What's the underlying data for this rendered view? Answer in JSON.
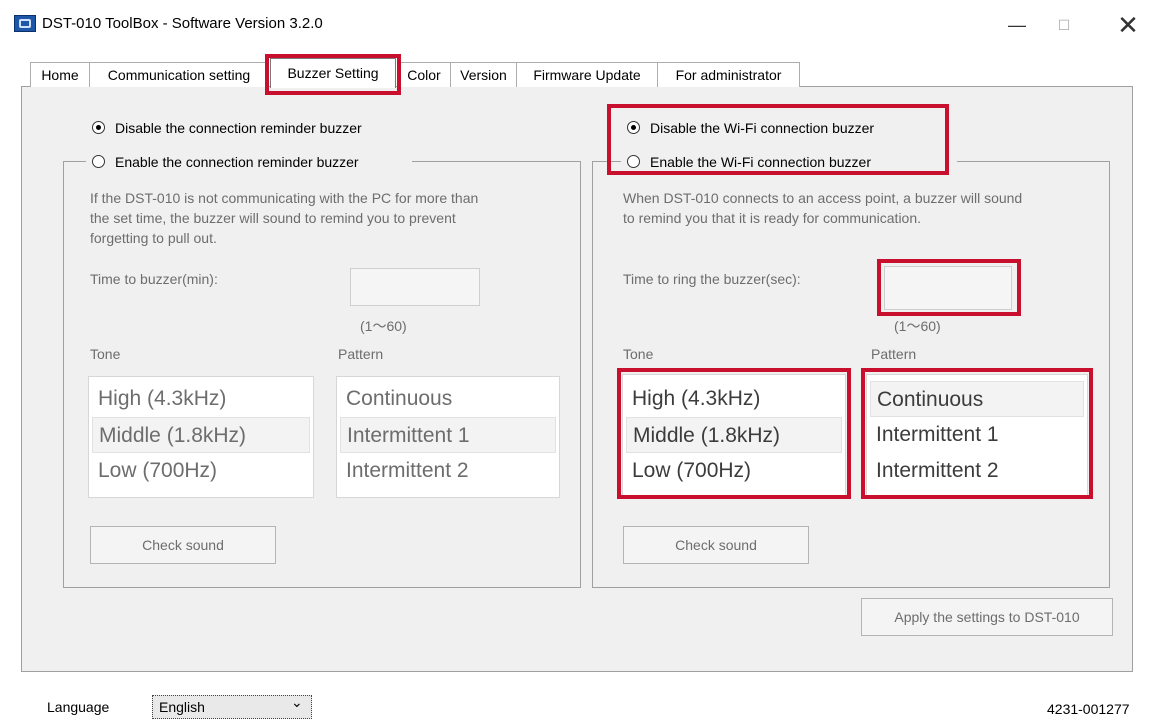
{
  "window": {
    "title": "DST-010 ToolBox - Software Version 3.2.0",
    "minimize": "—",
    "maximize": "☐",
    "close": "✕"
  },
  "tabs": [
    {
      "label": "Home"
    },
    {
      "label": "Communication setting"
    },
    {
      "label": "Buzzer Setting"
    },
    {
      "label": "Color"
    },
    {
      "label": "Version"
    },
    {
      "label": "Firmware Update"
    },
    {
      "label": "For administrator"
    }
  ],
  "active_tab": "Buzzer Setting",
  "reminder": {
    "disable_label": "Disable the connection reminder buzzer",
    "enable_label": "Enable the connection reminder buzzer",
    "selected": "disable",
    "description": [
      "If the DST-010 is not communicating with the PC for more than",
      "the set time, the buzzer will sound to remind you to prevent",
      "forgetting to pull out."
    ],
    "time_label": "Time to buzzer(min):",
    "time_value": "",
    "range": "(1～60)",
    "tone_label": "Tone",
    "pattern_label": "Pattern",
    "tones": [
      "High (4.3kHz)",
      "Middle (1.8kHz)",
      "Low (700Hz)"
    ],
    "tone_selected": 1,
    "patterns": [
      "Continuous",
      "Intermittent 1",
      "Intermittent 2"
    ],
    "pattern_selected": 1,
    "check_sound": "Check sound"
  },
  "wifi": {
    "disable_label": "Disable the Wi-Fi connection buzzer",
    "enable_label": "Enable the Wi-Fi connection buzzer",
    "selected": "disable",
    "description": [
      "When DST-010 connects to an access point, a buzzer will sound",
      "to remind you that it is ready for communication."
    ],
    "time_label": "Time to ring the buzzer(sec):",
    "time_value": "",
    "range": "(1～60)",
    "tone_label": "Tone",
    "pattern_label": "Pattern",
    "tones": [
      "High (4.3kHz)",
      "Middle (1.8kHz)",
      "Low (700Hz)"
    ],
    "tone_selected": 1,
    "patterns": [
      "Continuous",
      "Intermittent 1",
      "Intermittent 2"
    ],
    "pattern_selected": 0,
    "check_sound": "Check sound"
  },
  "apply_button": "Apply the settings to DST-010",
  "footer": {
    "language_label": "Language",
    "language_value": "English",
    "dropdown_arrow": "⌄",
    "code": "4231-001277"
  },
  "colors": {
    "highlight": "#c8102e",
    "panel": "#f0f0f0"
  }
}
